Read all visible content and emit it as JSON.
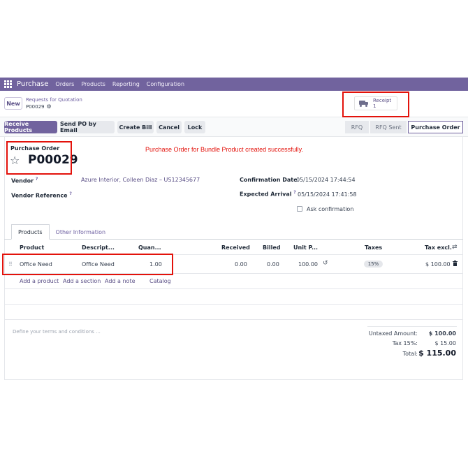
{
  "navbar": {
    "brand": "Purchase",
    "menu": [
      "Orders",
      "Products",
      "Reporting",
      "Configuration"
    ]
  },
  "control": {
    "new_label": "New",
    "breadcrumb_parent": "Requests for Quotation",
    "breadcrumb_current": "P00029",
    "smart_button": {
      "label": "Receipt",
      "count": "1"
    }
  },
  "actions": [
    "Receive Products",
    "Send PO by Email",
    "Create Bill",
    "Cancel",
    "Lock"
  ],
  "stages": [
    "RFQ",
    "RFQ Sent",
    "Purchase Order"
  ],
  "form": {
    "title_label": "Purchase Order",
    "name": "P00029",
    "success_message": "Purchase Order for Bundle Product created successfully.",
    "vendor_label": "Vendor",
    "vendor_value": "Azure Interior, Colleen Diaz – US12345677",
    "vendor_ref_label": "Vendor Reference",
    "confirm_label": "Confirmation Date",
    "confirm_value": "05/15/2024 17:44:54",
    "arrival_label": "Expected Arrival",
    "arrival_value": "05/15/2024 17:41:58",
    "ask_confirmation": "Ask confirmation"
  },
  "tabs": [
    "Products",
    "Other Information"
  ],
  "table": {
    "headers": [
      "Product",
      "Descript...",
      "Quan...",
      "Received",
      "Billed",
      "Unit P...",
      "Taxes",
      "Tax excl."
    ],
    "rows": [
      {
        "product": "Office Need",
        "description": "Office Need",
        "quantity": "1.00",
        "received": "0.00",
        "billed": "0.00",
        "unit_price": "100.00",
        "taxes": "15%",
        "tax_excl": "$ 100.00"
      }
    ],
    "add_links": [
      "Add a product",
      "Add a section",
      "Add a note",
      "Catalog"
    ]
  },
  "terms_placeholder": "Define your terms and conditions ...",
  "totals": {
    "untaxed_label": "Untaxed Amount:",
    "untaxed_value": "$ 100.00",
    "tax_label": "Tax 15%:",
    "tax_value": "$ 15.00",
    "total_label": "Total:",
    "total_value": "$ 115.00"
  },
  "colors": {
    "brand": "#71639e",
    "annotation": "#e3120b"
  }
}
